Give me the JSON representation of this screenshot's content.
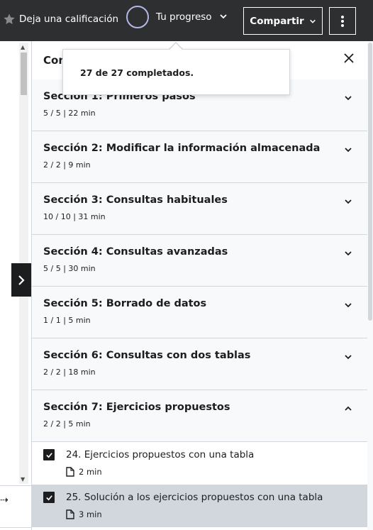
{
  "header": {
    "rate_label": "Deja una calificación",
    "progress_label": "Tu progreso",
    "share_label": "Compartir"
  },
  "tooltip": {
    "text": "27 de 27 completados."
  },
  "sidebar": {
    "title": "Contenido del curso",
    "sections": [
      {
        "title": "Sección 1: Primeros pasos",
        "meta": "5 / 5 | 22 min"
      },
      {
        "title": "Sección 2: Modificar la información almacenada",
        "meta": "2 / 2 | 9 min"
      },
      {
        "title": "Sección 3: Consultas habituales",
        "meta": "10 / 10 | 31 min"
      },
      {
        "title": "Sección 4: Consultas avanzadas",
        "meta": "5 / 5 | 30 min"
      },
      {
        "title": "Sección 5: Borrado de datos",
        "meta": "1 / 1 | 5 min"
      },
      {
        "title": "Sección 6: Consultas con dos tablas",
        "meta": "2 / 2 | 18 min"
      },
      {
        "title": "Sección 7: Ejercicios propuestos",
        "meta": "2 / 2 | 5 min"
      }
    ],
    "lessons": [
      {
        "title": "24. Ejercicios propuestos con una tabla",
        "duration": "2 min",
        "checked": true
      },
      {
        "title": "25. Solución a los ejercicios propuestos con una tabla",
        "duration": "3 min",
        "checked": true
      }
    ]
  },
  "colors": {
    "header_bg": "#2d2f31",
    "section_bg": "#f7f9fa",
    "active_lesson_bg": "#d1d7dc",
    "progress_ring": "#b5b8e6"
  }
}
